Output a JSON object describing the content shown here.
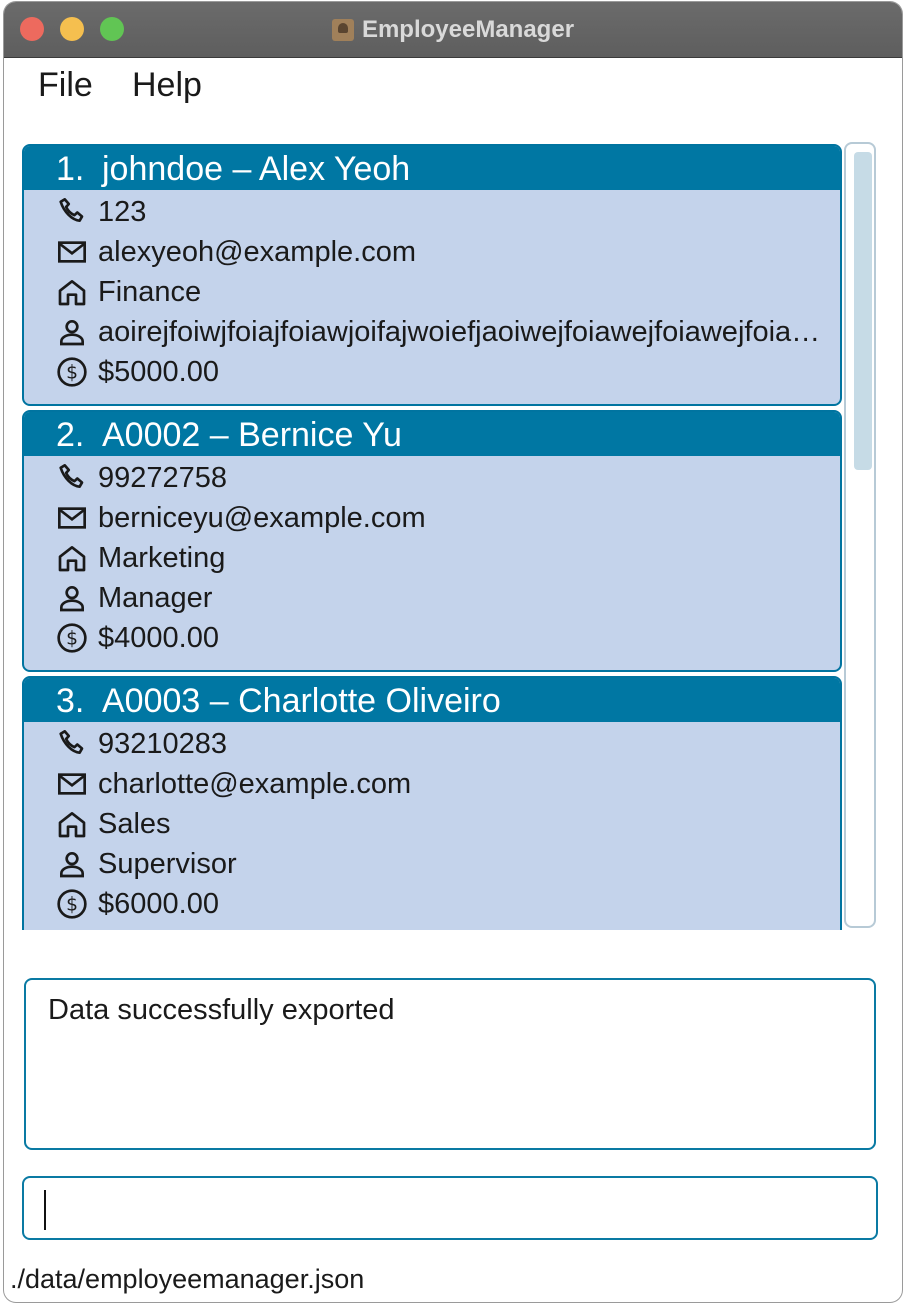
{
  "window": {
    "title": "EmployeeManager"
  },
  "menu": {
    "file": "File",
    "help": "Help"
  },
  "employees": [
    {
      "index": "1.",
      "header": "johndoe – Alex Yeoh",
      "phone": "123",
      "email": "alexyeoh@example.com",
      "department": "Finance",
      "role": "aoirejfoiwjfoiajfoiawjoifajwoiefjaoiwejfoiawejfoiawejfoiaw...",
      "salary": "$5000.00"
    },
    {
      "index": "2.",
      "header": "A0002 – Bernice Yu",
      "phone": "99272758",
      "email": "berniceyu@example.com",
      "department": "Marketing",
      "role": "Manager",
      "salary": "$4000.00"
    },
    {
      "index": "3.",
      "header": "A0003 – Charlotte Oliveiro",
      "phone": "93210283",
      "email": "charlotte@example.com",
      "department": "Sales",
      "role": "Supervisor",
      "salary": "$6000.00"
    }
  ],
  "result": {
    "message": "Data successfully exported"
  },
  "command": {
    "value": ""
  },
  "status": {
    "file_path": "./data/employeemanager.json"
  },
  "icons": {
    "phone": "phone-icon",
    "email": "mail-icon",
    "department": "home-icon",
    "role": "person-icon",
    "salary": "dollar-icon"
  },
  "colors": {
    "header": "#0077a3",
    "card": "#c4d3eb",
    "border": "#0a7aa3"
  }
}
